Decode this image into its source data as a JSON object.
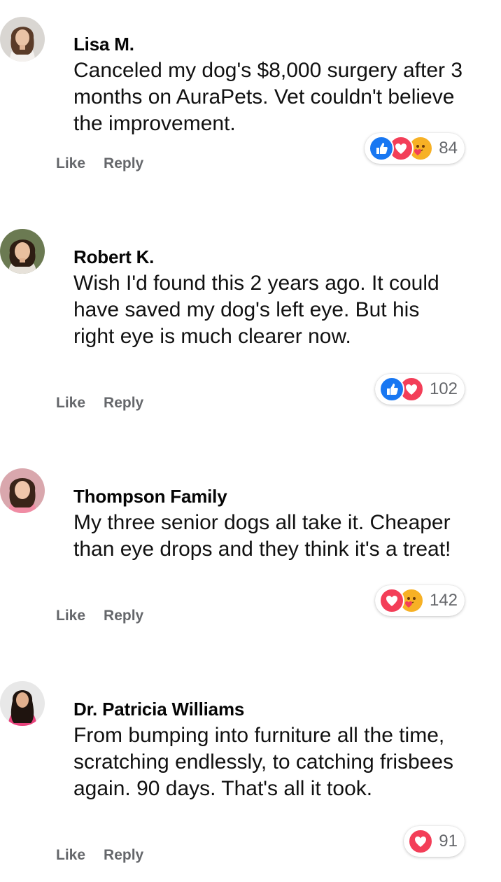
{
  "comments": [
    {
      "author": "Lisa M.",
      "text": "Canceled my dog's $8,000 surgery after 3 months on AuraPets. Vet couldn't believe the improvement.",
      "like_label": "Like",
      "reply_label": "Reply",
      "reaction_icons": [
        "like-icon",
        "love-icon",
        "care-icon"
      ],
      "reaction_count": "84"
    },
    {
      "author": "Robert K.",
      "text": "Wish I'd found this 2 years ago. It could have saved my dog's left eye. But his right eye is much clearer now.",
      "like_label": "Like",
      "reply_label": "Reply",
      "reaction_icons": [
        "like-icon",
        "love-icon"
      ],
      "reaction_count": "102"
    },
    {
      "author": "Thompson Family",
      "text": "My three senior dogs all take it. Cheaper than eye drops and they think it's a treat!",
      "like_label": "Like",
      "reply_label": "Reply",
      "reaction_icons": [
        "love-icon",
        "care-icon"
      ],
      "reaction_count": "142"
    },
    {
      "author": "Dr. Patricia Williams",
      "text": "From bumping into furniture all the time, scratching endlessly, to catching frisbees again. 90 days. That's all it took.",
      "like_label": "Like",
      "reply_label": "Reply",
      "reaction_icons": [
        "love-icon"
      ],
      "reaction_count": "91"
    }
  ],
  "colors": {
    "like_blue": "#1877f2",
    "love_red": "#f33e58",
    "care_yellow": "#f7b125",
    "action_gray": "#65676b"
  }
}
